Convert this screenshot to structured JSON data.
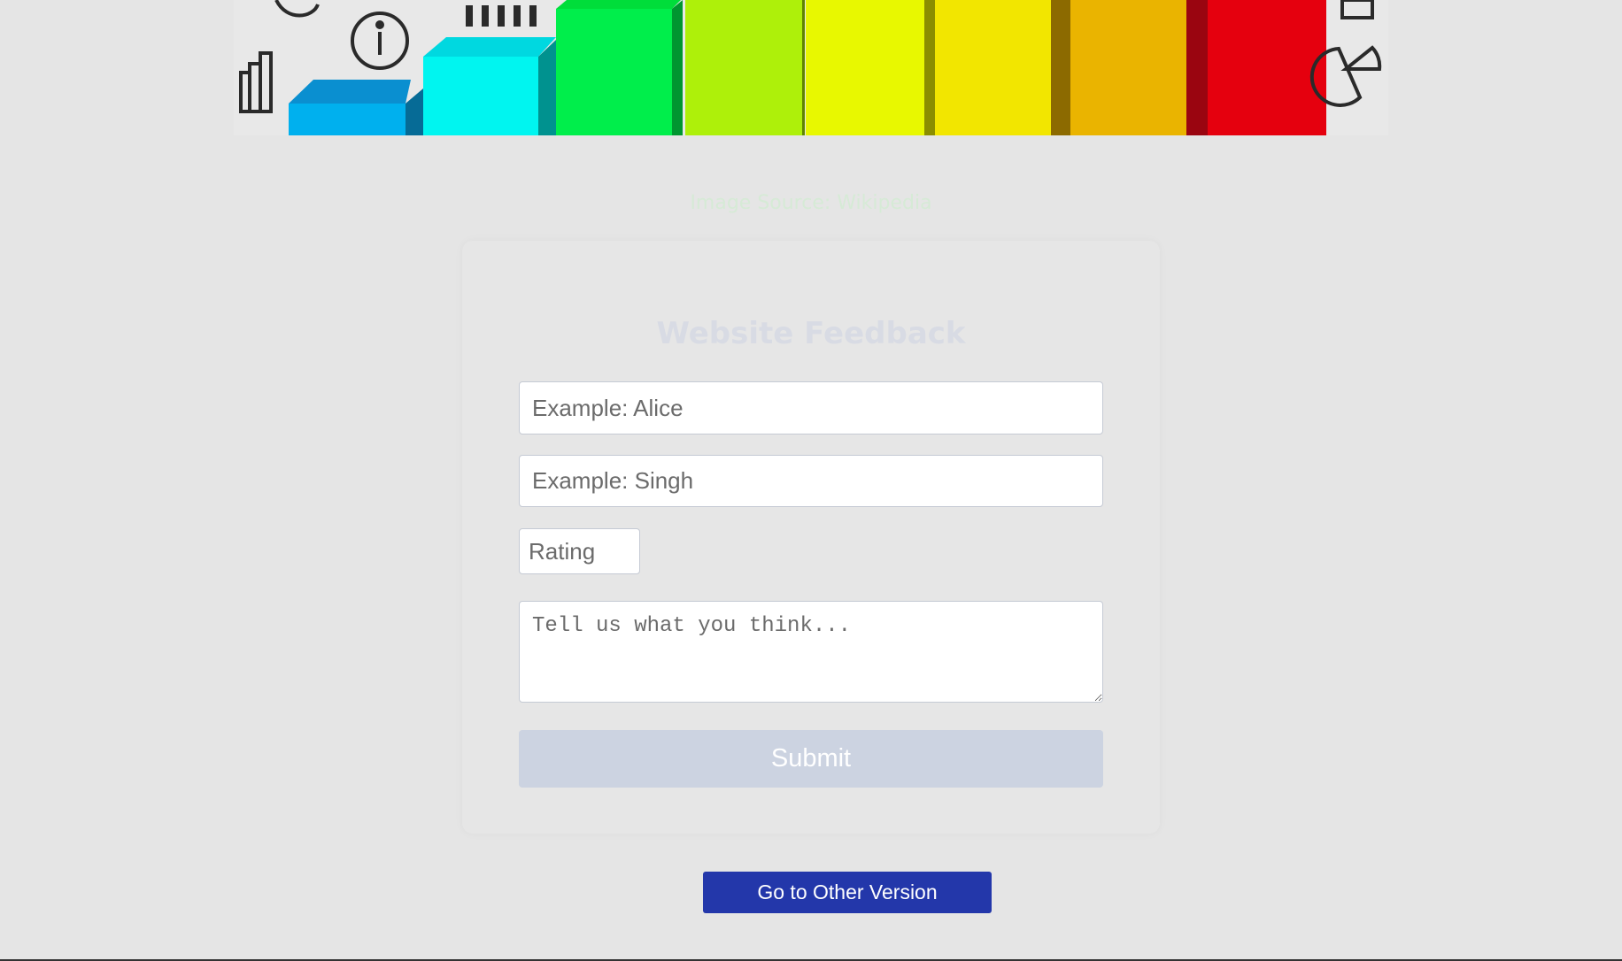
{
  "banner": {
    "alt": "bar chart banner image"
  },
  "image_source": {
    "text": "Image Source: Wikipedia"
  },
  "form": {
    "title": "Website Feedback",
    "first_name_placeholder": "Example: Alice",
    "last_name_placeholder": "Example: Singh",
    "rating_placeholder": "Rating",
    "comments_placeholder": "Tell us what you think...",
    "submit_label": "Submit"
  },
  "other_version": {
    "label": "Go to Other Version"
  },
  "colors": {
    "background": "#e5e5e5",
    "submit_bg": "#ccd3e1",
    "other_version_bg": "#2337aa"
  }
}
